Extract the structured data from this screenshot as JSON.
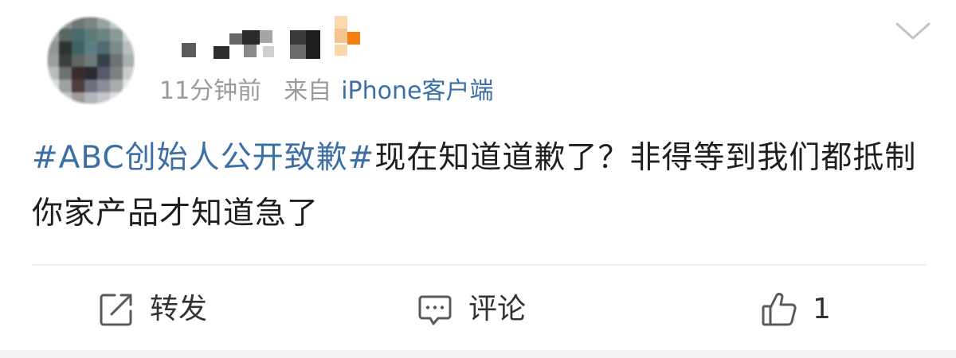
{
  "post": {
    "author_avatar": {
      "description_icon": "blurred-avatar"
    },
    "author_name": {
      "description_icon": "obscured-username"
    },
    "time": "11分钟前",
    "source_prefix": "来自",
    "source_client": "iPhone客户端",
    "topic": "#ABC创始人公开致歉#",
    "body": "现在知道道歉了？非得等到我们都抵制你家产品才知道急了"
  },
  "actions": {
    "repost": {
      "label": "转发",
      "icon": "repost-icon"
    },
    "comment": {
      "label": "评论",
      "icon": "comment-icon"
    },
    "like": {
      "count": "1",
      "icon": "thumbs-up-icon"
    }
  },
  "colors": {
    "link_blue": "#3b6fa5",
    "meta_gray": "#9b9b9b",
    "text_dark": "#1f1f1f",
    "icon_gray": "#5a5a5a"
  }
}
